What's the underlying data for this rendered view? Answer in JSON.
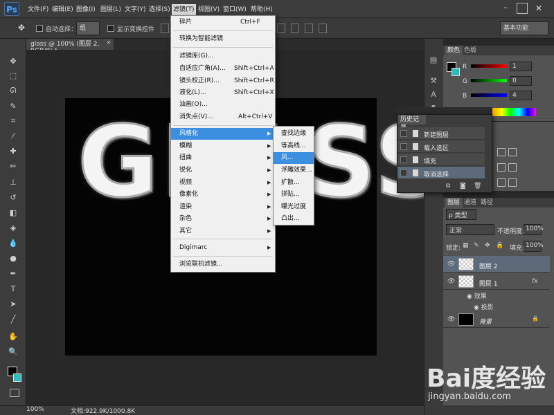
{
  "app": {
    "logo": "Ps"
  },
  "menubar": {
    "items": [
      "文件(F)",
      "编辑(E)",
      "图像(I)",
      "图层(L)",
      "文字(Y)",
      "选择(S)",
      "滤镜(T)",
      "视图(V)",
      "窗口(W)",
      "帮助(H)"
    ],
    "active": "滤镜(T)"
  },
  "options": {
    "auto_select_label": "自动选择：",
    "auto_select_value": "组",
    "transform_label": "显示变换控件",
    "workspace": "基本功能"
  },
  "document": {
    "tab_title": "glass @ 100% (图层 2, RGB/8) *",
    "canvas_text": "GLASS",
    "zoom": "100%",
    "doc_info": "文档:922.9K/1000.8K"
  },
  "filter_menu": {
    "items": [
      {
        "label": "碎片",
        "shortcut": "Ctrl+F"
      },
      {
        "label": "转换为智能滤镜",
        "shortcut": ""
      },
      {
        "label": "滤镜库(G)...",
        "shortcut": ""
      },
      {
        "label": "自适应广角(A)...",
        "shortcut": "Shift+Ctrl+A"
      },
      {
        "label": "镜头校正(R)...",
        "shortcut": "Shift+Ctrl+R"
      },
      {
        "label": "液化(L)...",
        "shortcut": "Shift+Ctrl+X"
      },
      {
        "label": "油画(O)...",
        "shortcut": ""
      },
      {
        "label": "消失点(V)...",
        "shortcut": "Alt+Ctrl+V"
      },
      {
        "label": "风格化",
        "shortcut": ""
      },
      {
        "label": "模糊",
        "shortcut": ""
      },
      {
        "label": "扭曲",
        "shortcut": ""
      },
      {
        "label": "锐化",
        "shortcut": ""
      },
      {
        "label": "视频",
        "shortcut": ""
      },
      {
        "label": "像素化",
        "shortcut": ""
      },
      {
        "label": "渲染",
        "shortcut": ""
      },
      {
        "label": "杂色",
        "shortcut": ""
      },
      {
        "label": "其它",
        "shortcut": ""
      },
      {
        "label": "Digimarc",
        "shortcut": ""
      },
      {
        "label": "浏览联机滤镜...",
        "shortcut": ""
      }
    ],
    "highlighted": "风格化"
  },
  "stylize_menu": {
    "items": [
      "查找边缘",
      "等高线...",
      "风...",
      "浮雕效果...",
      "扩散...",
      "拼贴...",
      "曝光过度",
      "凸出..."
    ],
    "highlighted": "风..."
  },
  "color_panel": {
    "tabs": [
      "颜色",
      "色板"
    ],
    "r": {
      "letter": "R",
      "value": "1"
    },
    "g": {
      "letter": "G",
      "value": "0"
    },
    "b": {
      "letter": "B",
      "value": "4"
    },
    "fg_color": "#000000",
    "bg_color": "#2bbcbc"
  },
  "history_panel": {
    "title": "历史记录",
    "items": [
      "新建图层",
      "载入选区",
      "填充",
      "取消选择"
    ]
  },
  "layers_panel": {
    "tabs": [
      "图层",
      "通道",
      "路径"
    ],
    "kind": "ρ 类型",
    "blend_mode": "正常",
    "opacity_label": "不透明度:",
    "opacity": "100%",
    "lock_label": "锁定:",
    "fill_label": "填充:",
    "fill": "100%",
    "layers": [
      {
        "name": "图层 2"
      },
      {
        "name": "图层 1",
        "fx": "fx"
      },
      {
        "name": "背景"
      }
    ],
    "effects_label": "效果",
    "effect_item": "投影"
  },
  "watermark": {
    "logo": "Bai度经验",
    "url": "jingyan.baidu.com"
  }
}
